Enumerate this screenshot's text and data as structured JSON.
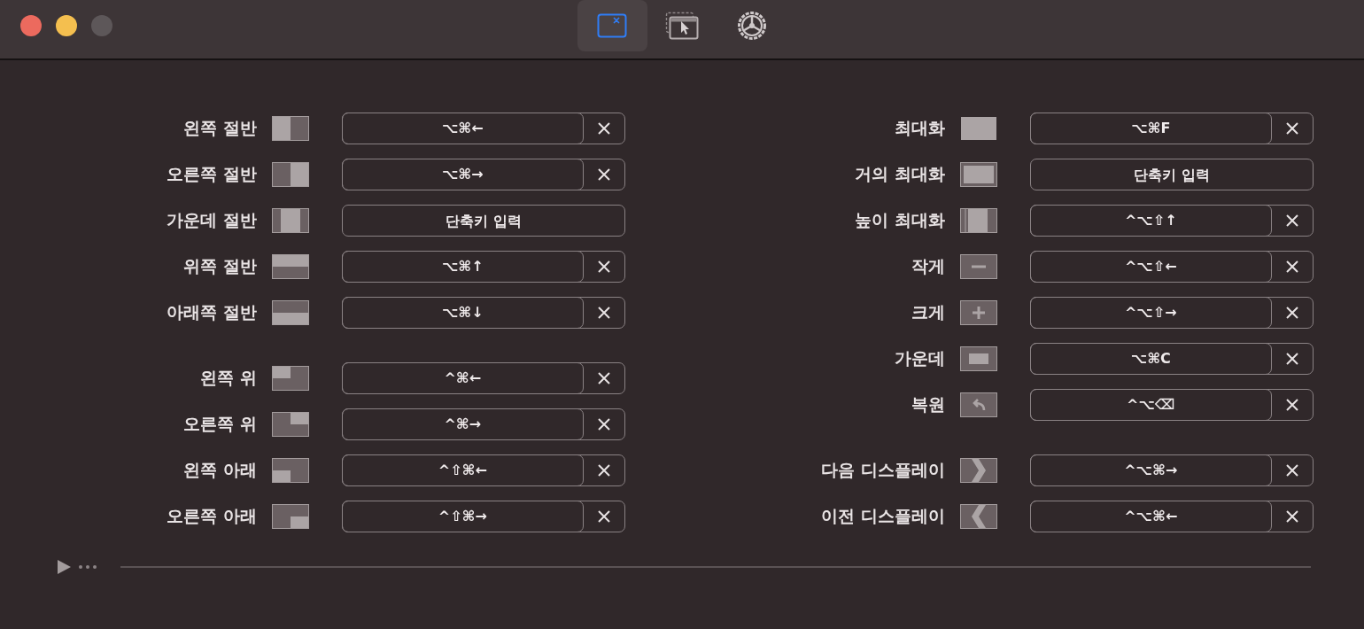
{
  "toolbar": {
    "tabs": [
      {
        "kind": "window",
        "selected": true
      },
      {
        "kind": "cursor",
        "selected": false
      },
      {
        "kind": "gear",
        "selected": false
      }
    ]
  },
  "columns": [
    {
      "groups": [
        {
          "items": [
            {
              "label": "왼쪽 절반",
              "kind": "left-half",
              "shortcut": {
                "value": "⌥⌘←"
              }
            },
            {
              "label": "오른쪽 절반",
              "kind": "right-half",
              "shortcut": {
                "value": "⌥⌘→"
              }
            },
            {
              "label": "가운데 절반",
              "kind": "center-half",
              "shortcut": {
                "placeholder": "단축키 입력"
              }
            },
            {
              "label": "위쪽 절반",
              "kind": "top-half",
              "shortcut": {
                "value": "⌥⌘↑"
              }
            },
            {
              "label": "아래쪽 절반",
              "kind": "bottom-half",
              "shortcut": {
                "value": "⌥⌘↓"
              }
            }
          ]
        },
        {
          "items": [
            {
              "label": "왼쪽 위",
              "kind": "top-left",
              "shortcut": {
                "value": "^⌘←"
              }
            },
            {
              "label": "오른쪽 위",
              "kind": "top-right",
              "shortcut": {
                "value": "^⌘→"
              }
            },
            {
              "label": "왼쪽 아래",
              "kind": "bottom-left",
              "shortcut": {
                "value": "^⇧⌘←"
              }
            },
            {
              "label": "오른쪽 아래",
              "kind": "bottom-right",
              "shortcut": {
                "value": "^⇧⌘→"
              }
            }
          ]
        }
      ]
    },
    {
      "groups": [
        {
          "items": [
            {
              "label": "최대화",
              "kind": "maximize",
              "shortcut": {
                "value": "⌥⌘F"
              }
            },
            {
              "label": "거의 최대화",
              "kind": "almost-maximize",
              "shortcut": {
                "placeholder": "단축키 입력"
              }
            },
            {
              "label": "높이 최대화",
              "kind": "maximize-height",
              "shortcut": {
                "value": "^⌥⇧↑"
              }
            },
            {
              "label": "작게",
              "kind": "smaller",
              "shortcut": {
                "value": "^⌥⇧←"
              }
            },
            {
              "label": "크게",
              "kind": "larger",
              "shortcut": {
                "value": "^⌥⇧→"
              }
            },
            {
              "label": "가운데",
              "kind": "center",
              "shortcut": {
                "value": "⌥⌘C"
              }
            },
            {
              "label": "복원",
              "kind": "restore",
              "shortcut": {
                "value": "^⌥⌫"
              }
            }
          ]
        },
        {
          "items": [
            {
              "label": "다음 디스플레이",
              "kind": "next-display",
              "shortcut": {
                "value": "^⌥⌘→"
              }
            },
            {
              "label": "이전 디스플레이",
              "kind": "previous-display",
              "shortcut": {
                "value": "^⌥⌘←"
              }
            }
          ]
        }
      ]
    }
  ],
  "footer": {
    "expanded": false
  }
}
